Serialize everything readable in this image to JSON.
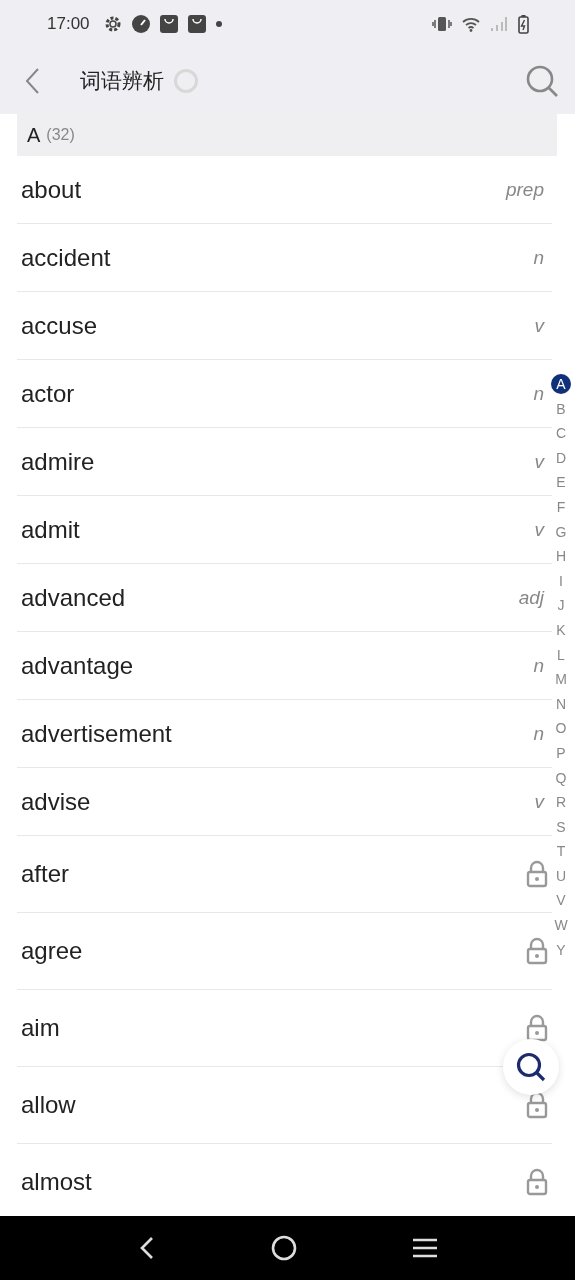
{
  "status_bar": {
    "time": "17:00"
  },
  "header": {
    "title": "词语辨析"
  },
  "section": {
    "letter": "A",
    "count": "(32)"
  },
  "words": [
    {
      "word": "about",
      "pos": "prep",
      "locked": false
    },
    {
      "word": "accident",
      "pos": "n",
      "locked": false
    },
    {
      "word": "accuse",
      "pos": "v",
      "locked": false
    },
    {
      "word": "actor",
      "pos": "n",
      "locked": false
    },
    {
      "word": "admire",
      "pos": "v",
      "locked": false
    },
    {
      "word": "admit",
      "pos": "v",
      "locked": false
    },
    {
      "word": "advanced",
      "pos": "adj",
      "locked": false
    },
    {
      "word": "advantage",
      "pos": "n",
      "locked": false
    },
    {
      "word": "advertisement",
      "pos": "n",
      "locked": false
    },
    {
      "word": "advise",
      "pos": "v",
      "locked": false
    },
    {
      "word": "after",
      "locked": true
    },
    {
      "word": "agree",
      "locked": true
    },
    {
      "word": "aim",
      "locked": true
    },
    {
      "word": "allow",
      "locked": true
    },
    {
      "word": "almost",
      "locked": true
    }
  ],
  "index": [
    {
      "letter": "A",
      "selected": true
    },
    {
      "letter": "B",
      "selected": false
    },
    {
      "letter": "C",
      "selected": false
    },
    {
      "letter": "D",
      "selected": false
    },
    {
      "letter": "E",
      "selected": false
    },
    {
      "letter": "F",
      "selected": false
    },
    {
      "letter": "G",
      "selected": false
    },
    {
      "letter": "H",
      "selected": false
    },
    {
      "letter": "I",
      "selected": false
    },
    {
      "letter": "J",
      "selected": false
    },
    {
      "letter": "K",
      "selected": false
    },
    {
      "letter": "L",
      "selected": false
    },
    {
      "letter": "M",
      "selected": false
    },
    {
      "letter": "N",
      "selected": false
    },
    {
      "letter": "O",
      "selected": false
    },
    {
      "letter": "P",
      "selected": false
    },
    {
      "letter": "Q",
      "selected": false
    },
    {
      "letter": "R",
      "selected": false
    },
    {
      "letter": "S",
      "selected": false
    },
    {
      "letter": "T",
      "selected": false
    },
    {
      "letter": "U",
      "selected": false
    },
    {
      "letter": "V",
      "selected": false
    },
    {
      "letter": "W",
      "selected": false
    },
    {
      "letter": "Y",
      "selected": false
    }
  ]
}
